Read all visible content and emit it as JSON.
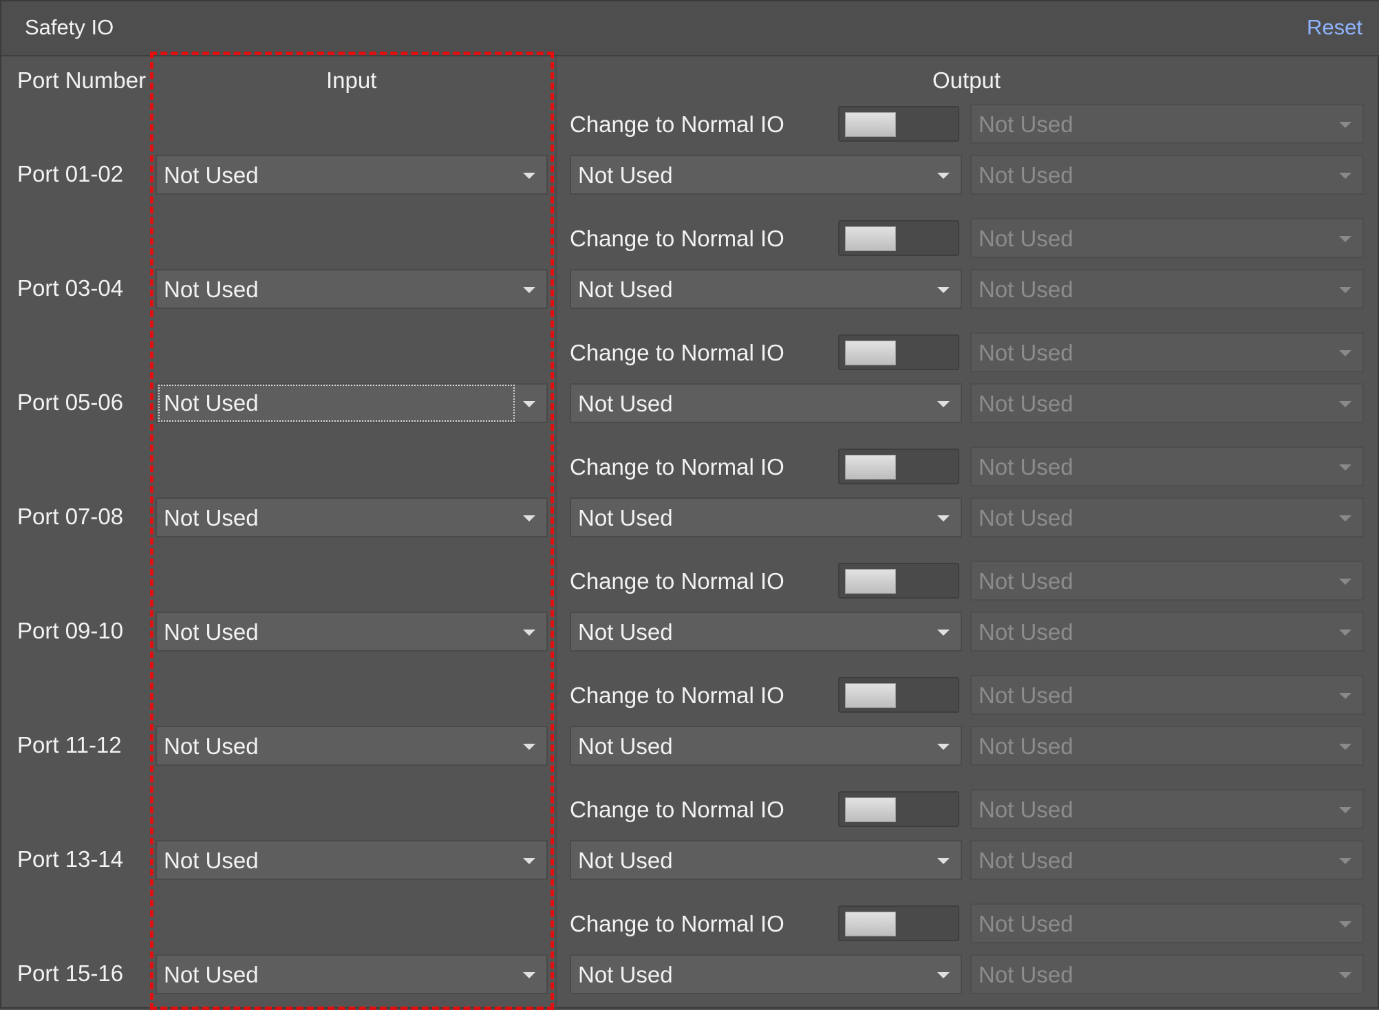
{
  "panel": {
    "title": "Safety IO",
    "reset_label": "Reset"
  },
  "headers": {
    "port_number": "Port Number",
    "input": "Input",
    "output": "Output"
  },
  "ports": [
    {
      "label": "Port 01-02",
      "input": "Not Used",
      "change_label": "Change to Normal IO",
      "change_select": "Not Used",
      "output": "Not Used",
      "output2": "Not Used",
      "toggle_on": false
    },
    {
      "label": "Port 03-04",
      "input": "Not Used",
      "change_label": "Change to Normal IO",
      "change_select": "Not Used",
      "output": "Not Used",
      "output2": "Not Used",
      "toggle_on": false
    },
    {
      "label": "Port 05-06",
      "input": "Not Used",
      "change_label": "Change to Normal IO",
      "change_select": "Not Used",
      "output": "Not Used",
      "output2": "Not Used",
      "toggle_on": false,
      "input_focused": true
    },
    {
      "label": "Port 07-08",
      "input": "Not Used",
      "change_label": "Change to Normal IO",
      "change_select": "Not Used",
      "output": "Not Used",
      "output2": "Not Used",
      "toggle_on": false
    },
    {
      "label": "Port 09-10",
      "input": "Not Used",
      "change_label": "Change to Normal IO",
      "change_select": "Not Used",
      "output": "Not Used",
      "output2": "Not Used",
      "toggle_on": false
    },
    {
      "label": "Port 11-12",
      "input": "Not Used",
      "change_label": "Change to Normal IO",
      "change_select": "Not Used",
      "output": "Not Used",
      "output2": "Not Used",
      "toggle_on": false
    },
    {
      "label": "Port 13-14",
      "input": "Not Used",
      "change_label": "Change to Normal IO",
      "change_select": "Not Used",
      "output": "Not Used",
      "output2": "Not Used",
      "toggle_on": false
    },
    {
      "label": "Port 15-16",
      "input": "Not Used",
      "change_label": "Change to Normal IO",
      "change_select": "Not Used",
      "output": "Not Used",
      "output2": "Not Used",
      "toggle_on": false
    }
  ],
  "colors": {
    "background": "#545454",
    "reset_link": "#8fb3ff",
    "highlight_box": "#e01010",
    "disabled_text": "#8c8c8c"
  }
}
